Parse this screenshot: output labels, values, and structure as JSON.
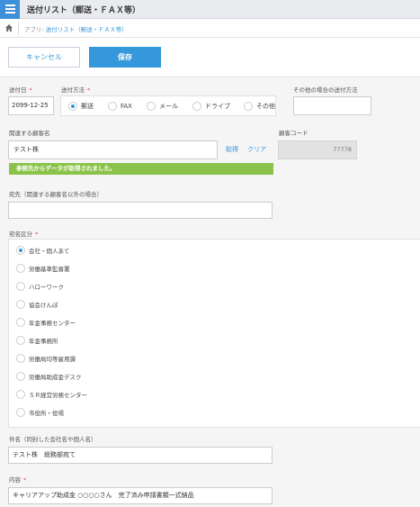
{
  "header": {
    "title": "送付リスト（郵送・ＦＡＸ等）"
  },
  "breadcrumb": {
    "prefix": "アプリ:",
    "app_link": "送付リスト（郵送・ＦＡＸ等）"
  },
  "actions": {
    "cancel_label": "キャンセル",
    "save_label": "保存"
  },
  "form": {
    "send_date": {
      "label": "送付日",
      "required_mark": "*",
      "value": "2099-12-25"
    },
    "send_method": {
      "label": "送付方法",
      "required_mark": "*",
      "selected": "郵送",
      "options": [
        "郵送",
        "FAX",
        "メール",
        "ドライブ",
        "その他"
      ]
    },
    "other_method": {
      "label": "その他の場合の送付方法",
      "value": ""
    },
    "related_customer": {
      "label": "関連する顧客名",
      "value": "テスト株",
      "fetch_label": "取得",
      "clear_label": "クリア",
      "message": "参照先からデータが取得されました。"
    },
    "customer_code": {
      "label": "顧客コード",
      "value": "77778"
    },
    "recipient": {
      "label": "宛先（関連する顧客名以外の場合）",
      "value": ""
    },
    "addressee_type": {
      "label": "宛名区分",
      "required_mark": "*",
      "selected": "会社・個人あて",
      "options": [
        "会社・個人あて",
        "労働基準監督署",
        "ハローワーク",
        "協会けんぽ",
        "年金事務センター",
        "年金事務所",
        "労働局均等雇用課",
        "労働局助成金デスク",
        "ＳＲ経営労務センター",
        "市役所・役場"
      ]
    },
    "subject": {
      "label": "件名（同封した会社名や個人名）",
      "value": "テスト株　総務部宛て"
    },
    "content": {
      "label": "内容",
      "required_mark": "*",
      "value": "キャリアアップ助成金 ○○○○さん　完了済み申請書類一式納品"
    }
  }
}
